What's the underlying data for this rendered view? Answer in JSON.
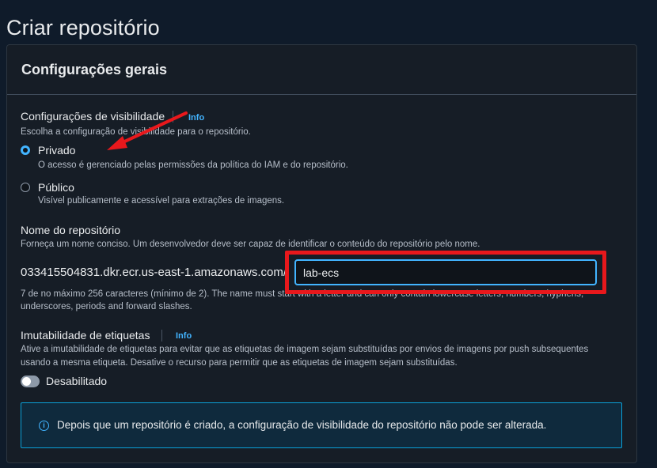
{
  "page": {
    "title": "Criar repositório"
  },
  "panel": {
    "title": "Configurações gerais"
  },
  "visibility": {
    "label": "Configurações de visibilidade",
    "info": "Info",
    "description": "Escolha a configuração de visibilidade para o repositório.",
    "options": [
      {
        "label": "Privado",
        "description": "O acesso é gerenciado pelas permissões da política do IAM e do repositório.",
        "selected": true
      },
      {
        "label": "Público",
        "description": "Visível publicamente e acessível para extrações de imagens.",
        "selected": false
      }
    ]
  },
  "repo_name": {
    "label": "Nome do repositório",
    "description": "Forneça um nome conciso. Um desenvolvedor deve ser capaz de identificar o conteúdo do repositório pelo nome.",
    "prefix": "033415504831.dkr.ecr.us-east-1.amazonaws.com/",
    "value": "lab-ecs",
    "constraint_line1": "7 de no máximo 256 caracteres (mínimo de 2). The name must start with a letter and can only contain lowercase letters, numbers, hyphens,",
    "constraint_line2": "underscores, periods and forward slashes."
  },
  "immutability": {
    "label": "Imutabilidade de etiquetas",
    "info": "Info",
    "description_line1": "Ative a imutabilidade de etiquetas para evitar que as etiquetas de imagem sejam substituídas por envios de imagens por push subsequentes",
    "description_line2": "usando a mesma etiqueta. Desative o recurso para permitir que as etiquetas de imagem sejam substituídas.",
    "toggle_label": "Desabilitado",
    "enabled": false
  },
  "alert": {
    "text": "Depois que um repositório é criado, a configuração de visibilidade do repositório não pode ser alterada."
  },
  "colors": {
    "accent": "#42b4ff",
    "annotation": "#e8181c"
  }
}
